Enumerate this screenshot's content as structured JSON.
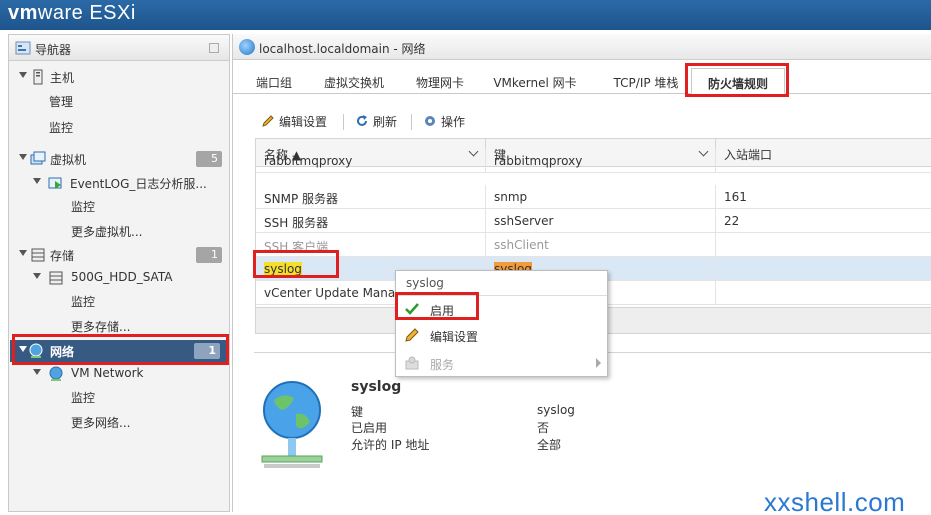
{
  "header": {
    "brand_vm": "vm",
    "brand_rest": "ware",
    "product": "ESXi",
    "brand_color": "#1e548c"
  },
  "navigator": {
    "title": "导航器",
    "items": [
      {
        "label": "主机",
        "icon": "host-icon"
      },
      {
        "label": "管理"
      },
      {
        "label": "监控"
      },
      {
        "label": "虚拟机",
        "badge": "5",
        "icon": "vm-icon"
      },
      {
        "label": "EventLOG_日志分析服...",
        "icon": "vm-running-icon"
      },
      {
        "label": "监控"
      },
      {
        "label": "更多虚拟机..."
      },
      {
        "label": "存储",
        "badge": "1",
        "icon": "storage-icon"
      },
      {
        "label": "500G_HDD_SATA",
        "icon": "datastore-icon"
      },
      {
        "label": "监控"
      },
      {
        "label": "更多存储..."
      },
      {
        "label": "网络",
        "badge": "1",
        "icon": "network-icon"
      },
      {
        "label": "VM Network",
        "icon": "network-icon"
      },
      {
        "label": "监控"
      },
      {
        "label": "更多网络..."
      }
    ]
  },
  "main": {
    "title": "localhost.localdomain - 网络",
    "tabs": [
      "端口组",
      "虚拟交换机",
      "物理网卡",
      "VMkernel 网卡",
      "TCP/IP 堆栈",
      "防火墙规则"
    ],
    "active_tab": "防火墙规则",
    "toolbar": {
      "edit": "编辑设置",
      "refresh": "刷新",
      "actions": "操作"
    },
    "grid": {
      "columns": [
        "名称 ▲",
        "键",
        "入站端口"
      ],
      "rows": [
        {
          "name": "rabbitmqproxy",
          "key": "rabbitmqproxy",
          "port": ""
        },
        {
          "name": "SNMP 服务器",
          "key": "snmp",
          "port": "161"
        },
        {
          "name": "SSH 服务器",
          "key": "sshServer",
          "port": "22"
        },
        {
          "name": "SSH 客户端",
          "key": "sshClient",
          "port": ""
        },
        {
          "name": "syslog",
          "key": "syslog",
          "port": ""
        },
        {
          "name": "vCenter Update Manager",
          "key": "",
          "port": ""
        }
      ]
    },
    "context_menu": {
      "title": "syslog",
      "items": [
        {
          "label": "启用",
          "icon": "check-icon"
        },
        {
          "label": "编辑设置",
          "icon": "pencil-icon"
        },
        {
          "label": "服务",
          "icon": "services-icon"
        }
      ]
    },
    "details": {
      "title": "syslog",
      "rows": [
        {
          "label": "键",
          "value": "syslog"
        },
        {
          "label": "已启用",
          "value": "否"
        },
        {
          "label": "允许的 IP 地址",
          "value": "全部"
        }
      ]
    }
  },
  "watermark": "xxshell.com"
}
